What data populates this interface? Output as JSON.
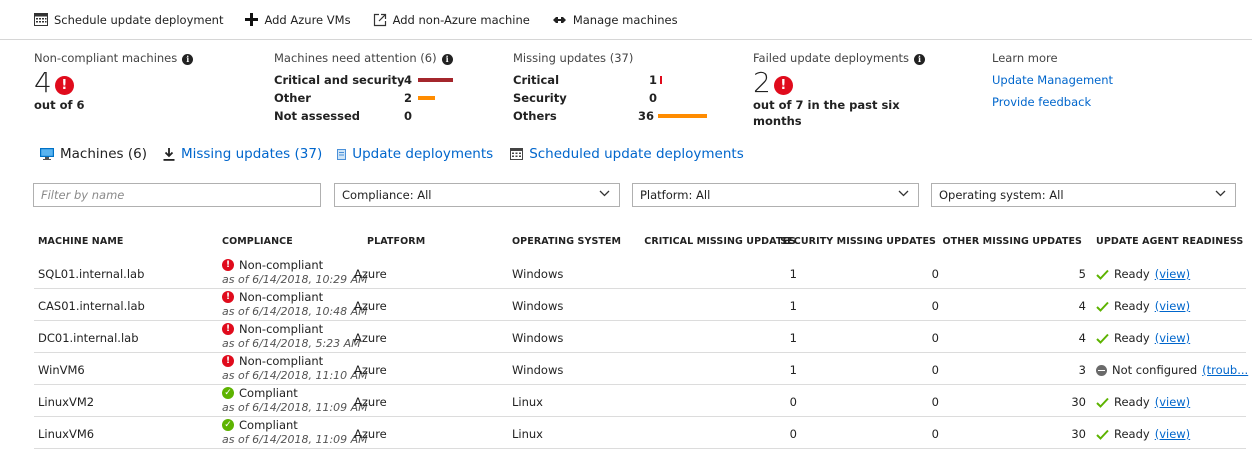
{
  "toolbar": {
    "schedule": "Schedule update deployment",
    "add_azure": "Add Azure VMs",
    "add_non_azure": "Add non-Azure machine",
    "manage": "Manage machines"
  },
  "summary": {
    "noncompliant": {
      "title": "Non-compliant machines",
      "value": "4",
      "sub": "out of 6"
    },
    "attention": {
      "title": "Machines need attention (6)",
      "rows": [
        {
          "label": "Critical and security",
          "count": "4",
          "level": 0.67,
          "color": "#a4262c"
        },
        {
          "label": "Other",
          "count": "2",
          "level": 0.33,
          "color": "#ff8c00"
        },
        {
          "label": "Not assessed",
          "count": "0",
          "level": 0,
          "color": "#ff8c00"
        }
      ]
    },
    "missing": {
      "title": "Missing updates (37)",
      "rows": [
        {
          "label": "Critical",
          "count": "1",
          "level": 0.03,
          "color": "#e00b1c"
        },
        {
          "label": "Security",
          "count": "0",
          "level": 0,
          "color": "#ff8c00"
        },
        {
          "label": "Others",
          "count": "36",
          "level": 0.97,
          "color": "#ff8c00"
        }
      ]
    },
    "failed": {
      "title": "Failed update deployments",
      "value": "2",
      "sub1": "out of 7 in the past six",
      "sub2": "months"
    },
    "learn": {
      "title": "Learn more",
      "link1": "Update Management",
      "link2": "Provide feedback"
    }
  },
  "tabs": [
    {
      "label": "Machines (6)",
      "icon": "machine-icon",
      "active": true
    },
    {
      "label": "Missing updates (37)",
      "icon": "download-icon",
      "active": false
    },
    {
      "label": "Update deployments",
      "icon": "deployment-icon",
      "active": false
    },
    {
      "label": "Scheduled update deployments",
      "icon": "calendar-icon",
      "active": false
    }
  ],
  "filters": {
    "name_placeholder": "Filter by name",
    "compliance": "Compliance: All",
    "platform": "Platform: All",
    "os": "Operating system: All"
  },
  "table": {
    "headers": [
      "MACHINE NAME",
      "COMPLIANCE",
      "PLATFORM",
      "OPERATING SYSTEM",
      "CRITICAL MISSING UPDATES",
      "SECURITY MISSING UPDATES",
      "OTHER MISSING UPDATES",
      "UPDATE AGENT READINESS"
    ],
    "rows": [
      {
        "name": "SQL01.internal.lab",
        "compliance": "Non-compliant",
        "status": "error",
        "timestamp": "as of 6/14/2018, 10:29 AM",
        "platform": "Azure",
        "os": "Windows",
        "critical": "1",
        "security": "0",
        "other": "5",
        "readiness": "Ready",
        "readiness_status": "ready",
        "link": "(view)"
      },
      {
        "name": "CAS01.internal.lab",
        "compliance": "Non-compliant",
        "status": "error",
        "timestamp": "as of 6/14/2018, 10:48 AM",
        "platform": "Azure",
        "os": "Windows",
        "critical": "1",
        "security": "0",
        "other": "4",
        "readiness": "Ready",
        "readiness_status": "ready",
        "link": "(view)"
      },
      {
        "name": "DC01.internal.lab",
        "compliance": "Non-compliant",
        "status": "error",
        "timestamp": "as of 6/14/2018, 5:23 AM",
        "platform": "Azure",
        "os": "Windows",
        "critical": "1",
        "security": "0",
        "other": "4",
        "readiness": "Ready",
        "readiness_status": "ready",
        "link": "(view)"
      },
      {
        "name": "WinVM6",
        "compliance": "Non-compliant",
        "status": "error",
        "timestamp": "as of 6/14/2018, 11:10 AM",
        "platform": "Azure",
        "os": "Windows",
        "critical": "1",
        "security": "0",
        "other": "3",
        "readiness": "Not configured",
        "readiness_status": "notconfigured",
        "link": "(troub..."
      },
      {
        "name": "LinuxVM2",
        "compliance": "Compliant",
        "status": "ok",
        "timestamp": "as of 6/14/2018, 11:09 AM",
        "platform": "Azure",
        "os": "Linux",
        "critical": "0",
        "security": "0",
        "other": "30",
        "readiness": "Ready",
        "readiness_status": "ready",
        "link": "(view)"
      },
      {
        "name": "LinuxVM6",
        "compliance": "Compliant",
        "status": "ok",
        "timestamp": "as of 6/14/2018, 11:09 AM",
        "platform": "Azure",
        "os": "Linux",
        "critical": "0",
        "security": "0",
        "other": "30",
        "readiness": "Ready",
        "readiness_status": "ready",
        "link": "(view)"
      }
    ]
  },
  "colors": {
    "link": "#0066cc",
    "error": "#e00b1c",
    "ok": "#5db300",
    "bar_red": "#a4262c",
    "bar_orange": "#ff8c00",
    "ready_check": "#5db300"
  }
}
